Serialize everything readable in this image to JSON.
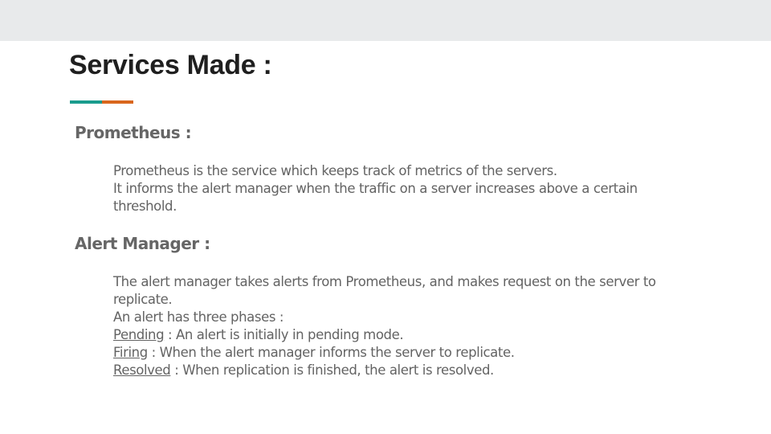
{
  "title": "Services Made :",
  "accent_colors": {
    "teal": "#1a9c8d",
    "orange": "#d9661d"
  },
  "sections": [
    {
      "heading": "Prometheus :",
      "lines": [
        "Prometheus is the service which keeps track of metrics of the servers.",
        "It informs the alert manager when the traffic on a server increases above a certain threshold."
      ]
    },
    {
      "heading": "Alert Manager :",
      "lines": [
        "The alert manager takes alerts from Prometheus,  and makes request on the server to replicate.",
        "An alert has three phases :"
      ],
      "phases": [
        {
          "term": "Pending",
          "description": " : An alert is initially in pending mode."
        },
        {
          "term": "Firing",
          "description": " : When the alert manager informs the server to replicate."
        },
        {
          "term": "Resolved",
          "description": " : When replication is finished, the alert is resolved."
        }
      ]
    }
  ]
}
